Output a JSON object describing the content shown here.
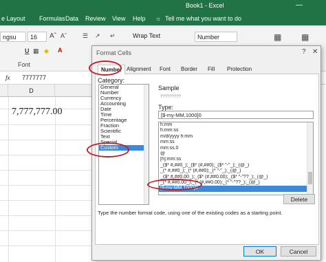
{
  "titlebar": {
    "title": "Book1 - Excel"
  },
  "ribbon_tabs": [
    "e Layout",
    "Formulas",
    "Data",
    "Review",
    "View",
    "Help",
    "Tell me what you want to do"
  ],
  "ribbon": {
    "font_name": "ngsu",
    "font_size": "16",
    "wrap_text": "Wrap Text",
    "number_format": "Number",
    "group_font": "Font"
  },
  "formula_bar": {
    "fx": "fx",
    "value": "7777777"
  },
  "grid": {
    "column_d": "D",
    "cell_value": "7,777,777.00"
  },
  "dialog": {
    "title": "Format Cells",
    "tabs": [
      "Number",
      "Alignment",
      "Font",
      "Border",
      "Fill",
      "Protection"
    ],
    "category_label": "Category:",
    "categories": [
      "General",
      "Number",
      "Currency",
      "Accounting",
      "Date",
      "Time",
      "Percentage",
      "Fraction",
      "Scientific",
      "Text",
      "Special",
      "Custom"
    ],
    "selected_category": "Custom",
    "sample_label": "Sample",
    "sample_value": "?????????",
    "type_label": "Type:",
    "type_value": "[$-my-MM,1000]0",
    "formats": [
      "h:mm",
      "h:mm:ss",
      "m/d/yyyy h:mm",
      "mm:ss",
      "mm:ss.0",
      "@",
      "[h]:mm:ss",
      "_($* #,##0_);_($* (#,##0);_($* \"-\"_);_(@_)",
      "_(* #,##0_);_(* (#,##0);_(* \"-\"_);_(@_)",
      "_($* #,##0.00_);_($* (#,##0.00);_($* \"-\"??_);_(@_)",
      "_(* #,##0.00_);_(* (#,##0.00);_(* \"-\"??_);_(@_)",
      "[$-my-MM,1000]0"
    ],
    "selected_format": "[$-my-MM,1000]0",
    "delete_label": "Delete",
    "hint": "Type the number format code, using one of the existing codes as a starting point.",
    "ok_label": "OK",
    "cancel_label": "Cancel"
  },
  "colors": {
    "excel_green": "#217346",
    "highlight_red": "#c0202a",
    "selection_blue": "#3b89d8"
  }
}
